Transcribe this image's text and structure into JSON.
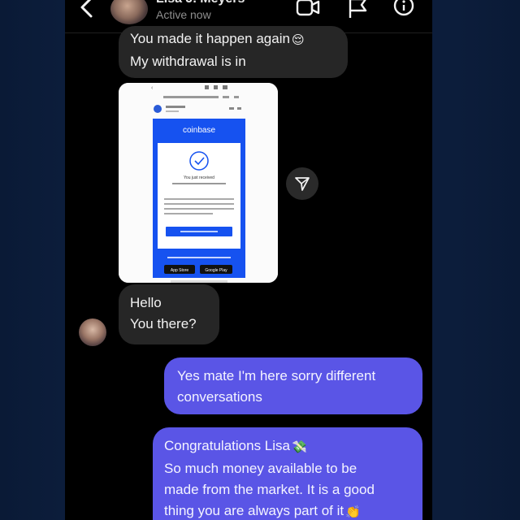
{
  "header": {
    "contact_name": "Lisa J. Meyers",
    "status": "Active now",
    "icons": [
      "back-icon",
      "avatar",
      "video-call-icon",
      "flag-icon",
      "info-icon"
    ]
  },
  "messages": [
    {
      "direction": "incoming",
      "lines": [
        "You made it happen again",
        "My withdrawal is in"
      ],
      "emoji": "😌"
    },
    {
      "direction": "incoming",
      "type": "image",
      "image": {
        "brand": "coinbase",
        "icon": "check-circle-icon",
        "heading": "You just received",
        "footer_badges": [
          "App Store",
          "Google Play"
        ]
      }
    },
    {
      "direction": "incoming",
      "lines": [
        "Hello",
        "You there?"
      ]
    },
    {
      "direction": "outgoing",
      "lines": [
        "Yes mate I'm here sorry different",
        "conversations"
      ]
    },
    {
      "direction": "outgoing",
      "lines": [
        "Congratulations Lisa",
        "So much money available to be",
        "made from the market. It is a good",
        "thing you are always part of it"
      ],
      "emojis": [
        "💸",
        "👏"
      ]
    }
  ],
  "colors": {
    "outgoing_bubble": "#5a55e6",
    "incoming_bubble": "#262626",
    "coinbase_blue": "#1652f0",
    "background": "#0c1d3b"
  }
}
